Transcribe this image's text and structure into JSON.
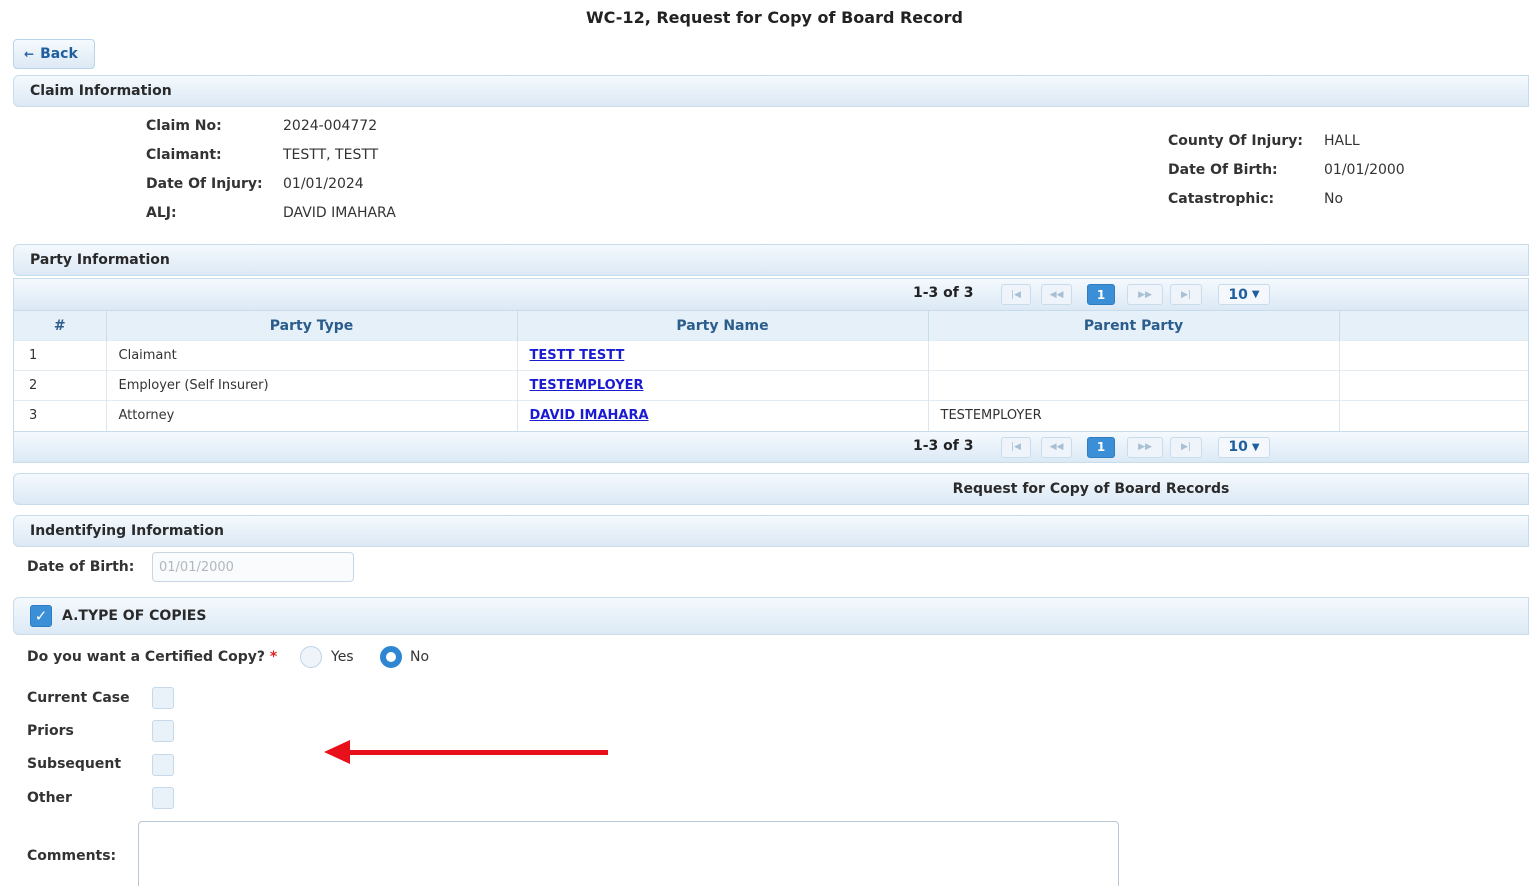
{
  "page_title": "WC-12, Request for Copy of Board Record",
  "back_label": "Back",
  "claim_section": {
    "title": "Claim Information",
    "left": [
      {
        "label": "Claim No:",
        "value": "2024-004772"
      },
      {
        "label": "Claimant:",
        "value": "TESTT, TESTT"
      },
      {
        "label": "Date Of Injury:",
        "value": "01/01/2024"
      },
      {
        "label": "ALJ:",
        "value": "DAVID IMAHARA"
      }
    ],
    "right": [
      {
        "label": "County Of Injury:",
        "value": "HALL"
      },
      {
        "label": "Date Of Birth:",
        "value": "01/01/2000"
      },
      {
        "label": "Catastrophic:",
        "value": "No"
      }
    ]
  },
  "party_section": {
    "title": "Party Information",
    "pager": {
      "count": "1-3 of 3",
      "page": "1",
      "page_size": "10"
    },
    "columns": [
      "#",
      "Party Type",
      "Party Name",
      "Parent Party"
    ],
    "rows": [
      {
        "num": "1",
        "type": "Claimant",
        "name": "TESTT TESTT",
        "parent": ""
      },
      {
        "num": "2",
        "type": "Employer (Self Insurer)",
        "name": "TESTEMPLOYER",
        "parent": ""
      },
      {
        "num": "3",
        "type": "Attorney",
        "name": "DAVID IMAHARA",
        "parent": "TESTEMPLOYER"
      }
    ]
  },
  "request_title": "Request for Copy of Board Records",
  "identifying": {
    "title": "Indentifying Information",
    "dob_label": "Date of Birth:",
    "dob_value": "01/01/2000"
  },
  "type_of_copies": {
    "title": "A.TYPE OF COPIES",
    "checked": true,
    "certified_label": "Do you want a Certified Copy?",
    "required_mark": "*",
    "yes_label": "Yes",
    "no_label": "No",
    "selected": "No",
    "options": [
      "Current Case",
      "Priors",
      "Subsequent",
      "Other"
    ],
    "comments_label": "Comments:"
  },
  "colors": {
    "accent": "#3a8fd6",
    "link": "#1b1bd1",
    "arrow": "#e8101a",
    "required": "#e02020"
  }
}
